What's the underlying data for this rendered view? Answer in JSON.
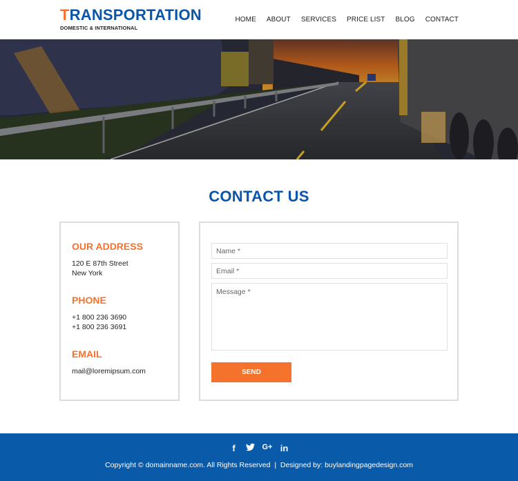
{
  "brand": {
    "title_first_letter": "T",
    "title_rest": "RANSPORTATION",
    "subtitle": "DOMESTIC & INTERNATIONAL"
  },
  "nav": {
    "items": [
      {
        "label": "HOME"
      },
      {
        "label": "ABOUT"
      },
      {
        "label": "SERVICES"
      },
      {
        "label": "PRICE LIST"
      },
      {
        "label": "BLOG"
      },
      {
        "label": "CONTACT"
      }
    ]
  },
  "hero": {
    "description": "Highway at sunset with a truck, guardrail, ship and containers"
  },
  "contact": {
    "title": "CONTACT US",
    "address": {
      "heading": "OUR ADDRESS",
      "line1": "120 E 87th Street",
      "line2": "New York"
    },
    "phone": {
      "heading": "PHONE",
      "line1": "+1 800 236 3690",
      "line2": "+1 800 236 3691"
    },
    "email": {
      "heading": "EMAIL",
      "value": "mail@loremipsum.com"
    },
    "form": {
      "name_placeholder": "Name *",
      "email_placeholder": "Email *",
      "message_placeholder": "Message *",
      "send_label": "SEND"
    }
  },
  "footer": {
    "social": [
      {
        "icon": "facebook-icon",
        "glyph": "f"
      },
      {
        "icon": "twitter-icon",
        "glyph": "🐦"
      },
      {
        "icon": "google-plus-icon",
        "glyph": "G+"
      },
      {
        "icon": "linkedin-icon",
        "glyph": "in"
      }
    ],
    "copyright": "Copyright © domainname.com. All Rights Reserved  |  Designed by: buylandingpagedesign.com"
  },
  "colors": {
    "primary_blue": "#0a55a8",
    "accent_orange": "#f4722b",
    "footer_blue": "#0a5aaa"
  }
}
